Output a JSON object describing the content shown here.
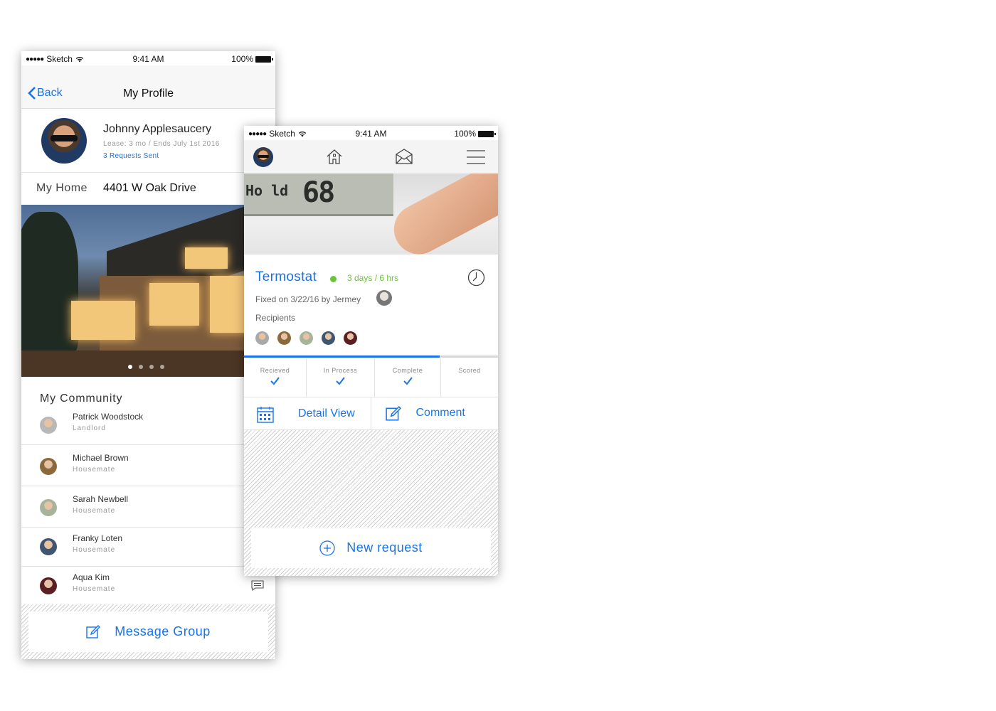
{
  "profile_screen": {
    "status": {
      "carrier": "Sketch",
      "time": "9:41 AM",
      "battery": "100%"
    },
    "nav": {
      "back_label": "Back",
      "title": "My Profile"
    },
    "user": {
      "name": "Johnny Applesaucery",
      "lease": "Lease: 3 mo / Ends July 1st 2016",
      "requests": "3 Requests Sent"
    },
    "home": {
      "label": "My Home",
      "address": "4401 W Oak Drive"
    },
    "carousel": {
      "page_count": 4,
      "active_index": 0
    },
    "community": {
      "title": "My Community",
      "members": [
        {
          "name": "Patrick Woodstock",
          "role": "Landlord",
          "avatar_color": "#b8b8b8"
        },
        {
          "name": "Michael Brown",
          "role": "Housemate",
          "avatar_color": "#8a6a3c"
        },
        {
          "name": "Sarah Newbell",
          "role": "Housemate",
          "avatar_color": "#a7b39a"
        },
        {
          "name": "Franky Loten",
          "role": "Housemate",
          "avatar_color": "#3f5570"
        },
        {
          "name": "Aqua Kim",
          "role": "Housemate",
          "avatar_color": "#5a1f22"
        }
      ]
    },
    "message_group_label": "Message Group"
  },
  "request_screen": {
    "status": {
      "carrier": "Sketch",
      "time": "9:41 AM",
      "battery": "100%"
    },
    "thermostat": {
      "hold": "Ho ld",
      "digits": "68"
    },
    "request": {
      "title": "Termostat",
      "status_color": "#6ac33a",
      "elapsed": "3 days / 6 hrs",
      "fixed": "Fixed on 3/22/16 by Jermey",
      "recipients_label": "Recipients",
      "recipient_colors": [
        "#a9a9a9",
        "#8a6a3c",
        "#a7b39a",
        "#3f5570",
        "#5a1f22"
      ]
    },
    "progress": 0.77,
    "stages": [
      {
        "label": "Recieved",
        "checked": true
      },
      {
        "label": "In Process",
        "checked": true
      },
      {
        "label": "Complete",
        "checked": true
      },
      {
        "label": "Scored",
        "checked": false
      }
    ],
    "actions": {
      "detail_label": "Detail View",
      "comment_label": "Comment"
    },
    "new_request_label": "New request",
    "accent_color": "#1a73e8"
  }
}
